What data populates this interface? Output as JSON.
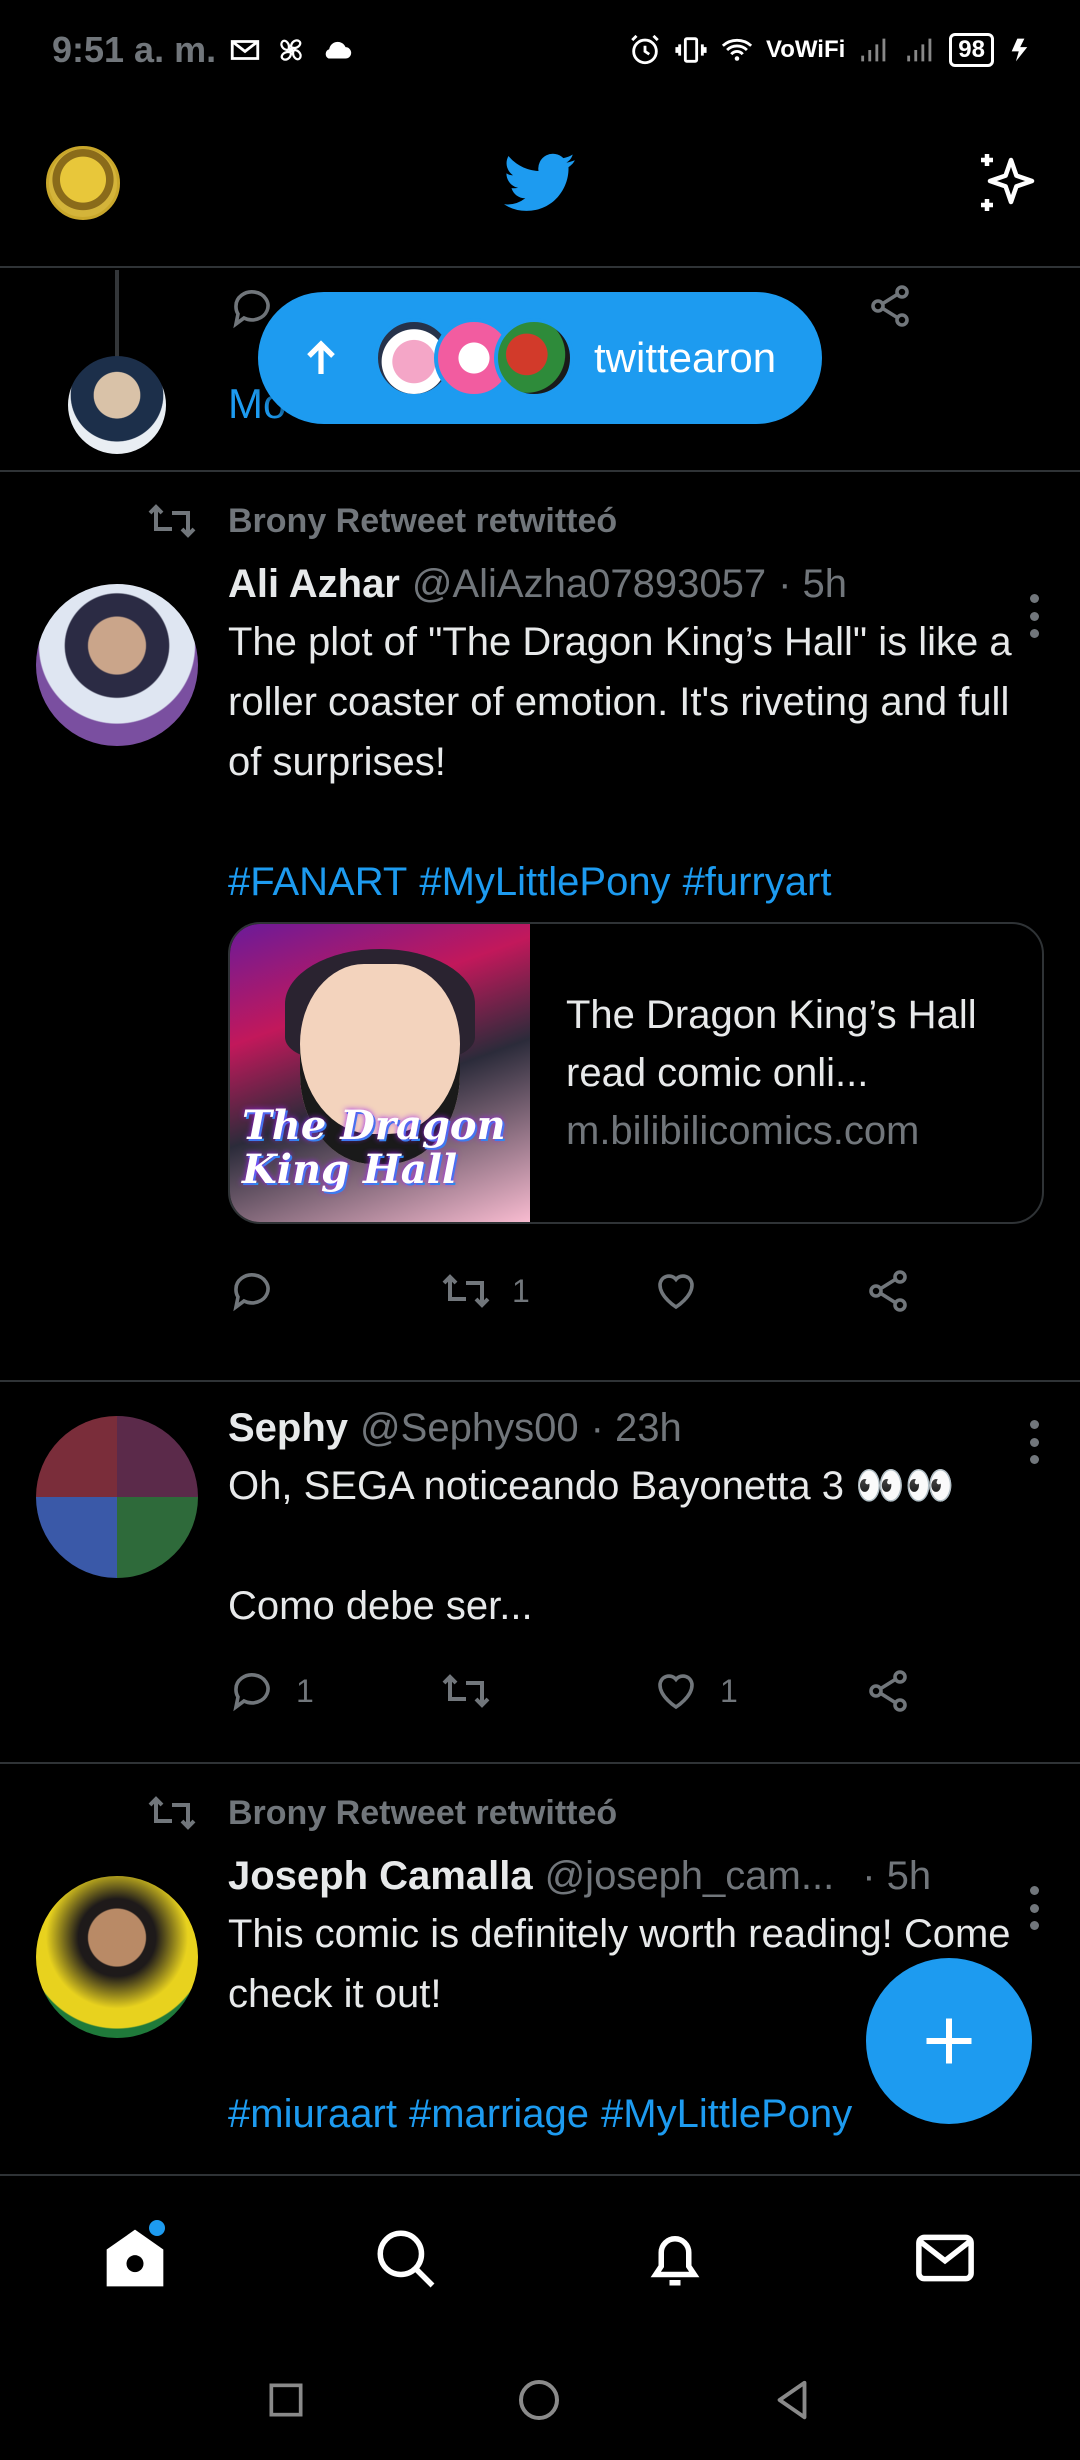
{
  "status_bar": {
    "time": "9:51 a. m.",
    "network": "VoWiFi",
    "battery": "98"
  },
  "new_tweets_pill": {
    "label": "twittearon"
  },
  "partial_tweet": {
    "link_text": "Mo"
  },
  "tweets": [
    {
      "retweeted_by": "Brony Retweet retwitteó",
      "name": "Ali Azhar",
      "handle": "@AliAzha07893057",
      "time": "· 5h",
      "text": "The plot of \"The Dragon King’s Hall\" is like a roller coaster of emotion. It's riveting and full of surprises!",
      "hashtags": [
        "#FANART",
        "#MyLittlePony",
        "#furryart"
      ],
      "card": {
        "image_title": "The Dragon King Hall",
        "title": "The Dragon King’s Hall read comic onli...",
        "domain": "m.bilibilicomics.com"
      },
      "stats": {
        "replies": "",
        "retweets": "1",
        "likes": ""
      }
    },
    {
      "name": "Sephy",
      "handle": "@Sephys00",
      "time": "· 23h",
      "text": "Oh, SEGA noticeando Bayonetta 3 👀👀",
      "text2": "Como debe ser...",
      "stats": {
        "replies": "1",
        "retweets": "",
        "likes": "1"
      }
    },
    {
      "retweeted_by": "Brony Retweet retwitteó",
      "name": "Joseph Camalla",
      "handle": "@joseph_cam...",
      "time": "· 5h",
      "text": "This comic is definitely worth reading! Come check it out!",
      "hashtags": [
        "#miuraart",
        "#marriage",
        "#MyLittlePony"
      ]
    }
  ],
  "colors": {
    "accent": "#1d9bf0",
    "background": "#000000",
    "muted": "#71767b",
    "divider": "#2f3336"
  },
  "icons": {
    "header_logo": "twitter-bird-icon",
    "header_right": "sparkle-icon",
    "nav": [
      "home-icon",
      "search-icon",
      "bell-icon",
      "mail-icon"
    ],
    "fab": "plus-icon"
  }
}
